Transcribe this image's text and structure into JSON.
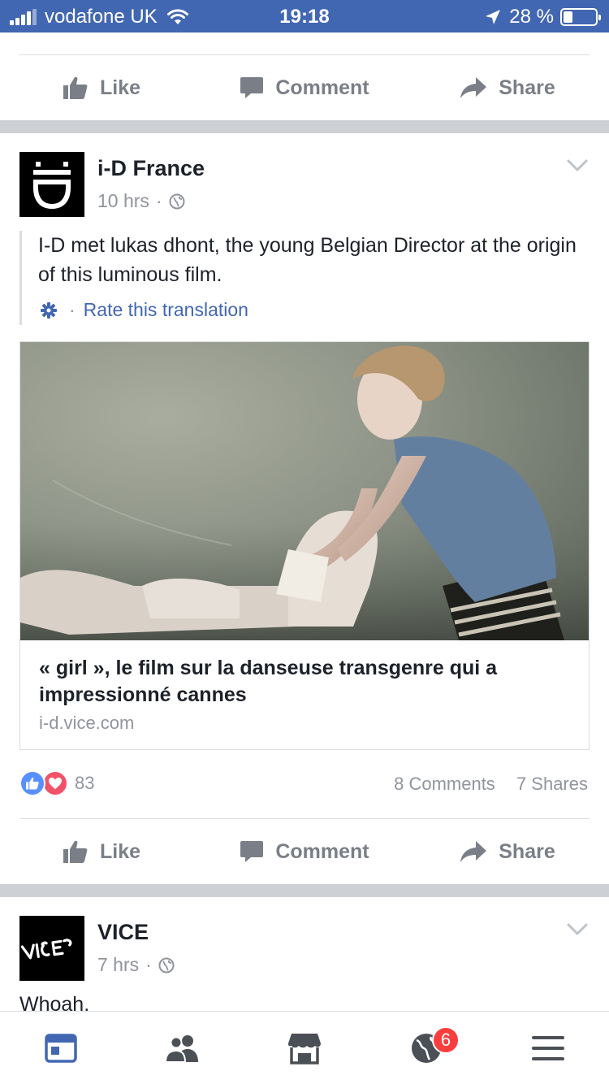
{
  "status_bar": {
    "carrier": "vodafone UK",
    "time": "19:18",
    "battery_percent": "28 %",
    "battery_level": 0.28
  },
  "top_actions": {
    "like": "Like",
    "comment": "Comment",
    "share": "Share"
  },
  "post": {
    "author": "i-D France",
    "time": "10 hrs",
    "meta_separator": "·",
    "text": "I-D met lukas dhont, the young Belgian Director at the origin of this luminous film.",
    "rate_separator": "·",
    "rate_translation": "Rate this translation",
    "link": {
      "title": "« girl », le film sur la danseuse transgenre qui a impressionné cannes",
      "domain": "i-d.vice.com"
    },
    "reaction_count": "83",
    "comments": "8 Comments",
    "shares": "7 Shares",
    "actions": {
      "like": "Like",
      "comment": "Comment",
      "share": "Share"
    }
  },
  "next_post": {
    "author": "VICE",
    "time": "7 hrs",
    "meta_separator": "·",
    "snippet": "Whoah."
  },
  "bottom_nav": {
    "notifications_badge": "6",
    "items": [
      "news-feed-icon",
      "friends-icon",
      "marketplace-icon",
      "notifications-globe-icon",
      "menu-icon"
    ]
  },
  "colors": {
    "brand": "#4267b2",
    "like_blue": "#5890ff",
    "love_red": "#f25268",
    "badge_red": "#fa3e3e",
    "muted": "#90949c"
  }
}
